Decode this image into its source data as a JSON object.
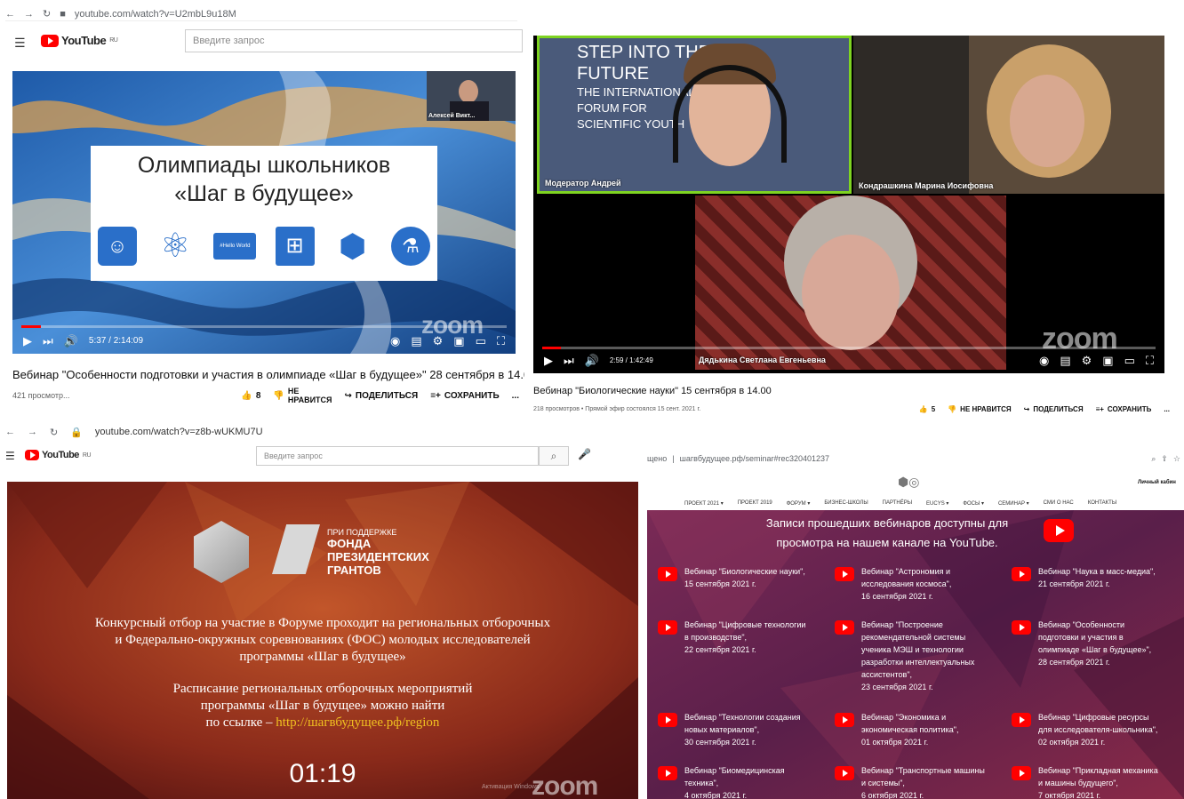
{
  "q1": {
    "url": "youtube.com/watch?v=U2mbL9u18M",
    "logo": "YouTube",
    "logo_region": "RU",
    "search_placeholder": "Введите запрос",
    "slide_title_1": "Олимпиады школьников",
    "slide_title_2": "«Шаг в будущее»",
    "slide_mini_text": "#Hello World",
    "speaker_name": "Алексей Викт...",
    "time": "5:37 / 2:14:09",
    "progress": 0.04,
    "watermark": "zoom",
    "title": "Вебинар \"Особенности подготовки и участия в олимпиаде «Шаг в будущее»\" 28 сентября в 14.00",
    "views": "421 просмотр...",
    "likes": "8",
    "dislike_label_1": "НЕ",
    "dislike_label_2": "НРАВИТСЯ",
    "share_label": "ПОДЕЛИТЬСЯ",
    "save_label": "СОХРАНИТЬ",
    "more": "...",
    "colors": {
      "accent": "#ff0000",
      "slide_bg": "#2f6fb5"
    }
  },
  "q2": {
    "banner_1": "STEP INTO THE",
    "banner_2": "FUTURE",
    "banner_3": "THE INTERNATIONAL",
    "banner_4": "FORUM FOR",
    "banner_5": "SCIENTIFIC YOUTH",
    "tile1_name": "Модератор Андрей",
    "tile2_name": "Кондрашкина Марина Иосифовна",
    "tile3_name": "Дядькина Светлана Евгеньевна",
    "time": "2:59 / 1:42:49",
    "progress": 0.03,
    "watermark": "zoom",
    "title": "Вебинар \"Биологические науки\" 15 сентября в 14.00",
    "meta": "218 просмотров • Прямой эфир состоялся 15 сент. 2021 г.",
    "likes": "5",
    "dislike_label": "НЕ НРАВИТСЯ",
    "share_label": "ПОДЕЛИТЬСЯ",
    "save_label": "СОХРАНИТЬ",
    "more": "...",
    "colors": {
      "active_speaker": "#7ed321"
    }
  },
  "q3": {
    "url": "youtube.com/watch?v=z8b-wUKMU7U",
    "logo": "YouTube",
    "logo_region": "RU",
    "search_placeholder": "Введите запрос",
    "support_1": "ПРИ ПОДДЕРЖКЕ",
    "support_2": "ФОНДА",
    "support_3": "ПРЕЗИДЕНТСКИХ",
    "support_4": "ГРАНТОВ",
    "para1_1": "Конкурсный отбор на участие в Форуме проходит на региональных отборочных",
    "para1_2": "и Федерально-окружных соревнованиях (ФОС) молодых исследователей",
    "para1_3": "программы «Шаг в будущее»",
    "para2_1": "Расписание региональных отборочных мероприятий",
    "para2_2": "программы «Шаг в будущее» можно найти",
    "para2_3_prefix": "по ссылке – ",
    "para2_link": "http://шагвбудущее.рф/region",
    "timer": "01:19",
    "watermark": "zoom",
    "corner": "Активация Windows",
    "colors": {
      "link": "#f0c020",
      "bg": "#8a2a1a"
    }
  },
  "q4": {
    "url_prefix": "щено",
    "url": "шагвбудущее.рф/seminar#rec320401237",
    "cabinet": "Личный кабин",
    "nav": [
      "ПРОЕКТ 2021 ▾",
      "ПРОЕКТ 2019",
      "ФОРУМ ▾",
      "БИЗНЕС-ШКОЛЫ",
      "ПАРТНЁРЫ",
      "EUCYS ▾",
      "ФОСЫ ▾",
      "СЕМИНАР ▾",
      "СМИ О НАС",
      "КОНТАКТЫ"
    ],
    "heading_1": "Записи прошедших вебинаров доступны для",
    "heading_2": "просмотра на нашем канале на YouTube.",
    "webinars": [
      [
        "Вебинар \"Биологические науки\",",
        "15 сентября 2021 г."
      ],
      [
        "Вебинар \"Астрономия и",
        "исследования космоса\",",
        "16 сентября 2021 г."
      ],
      [
        "Вебинар \"Наука в масс-медиа\",",
        "21 сентября 2021 г."
      ],
      [
        "Вебинар \"Цифровые технологии",
        "в производстве\",",
        "22 сентября 2021 г."
      ],
      [
        "Вебинар \"Построение",
        "рекомендательной системы",
        "ученика МЭШ и технологии",
        "разработки интеллектуальных",
        "ассистентов\",",
        "23 сентября 2021 г."
      ],
      [
        "Вебинар \"Особенности",
        "подготовки и участия в",
        "олимпиаде «Шаг в будущее»\",",
        "28 сентября 2021 г."
      ],
      [
        "Вебинар \"Технологии создания",
        "новых материалов\",",
        "30 сентября 2021 г."
      ],
      [
        "Вебинар \"Экономика и",
        "экономическая политика\",",
        "01 октября 2021 г."
      ],
      [
        "Вебинар \"Цифровые ресурсы",
        "для исследователя-школьника\",",
        "02 октября 2021 г."
      ],
      [
        "Вебинар \"Биомедицинская",
        "техника\",",
        "4 октября 2021 г."
      ],
      [
        "Вебинар \"Транспортные машины",
        "и системы\",",
        "6 октября 2021 г."
      ],
      [
        "Вебинар \"Прикладная механика",
        "и машины будущего\",",
        "7 октября 2021 г."
      ]
    ],
    "colors": {
      "bg": "#6b2350"
    }
  }
}
